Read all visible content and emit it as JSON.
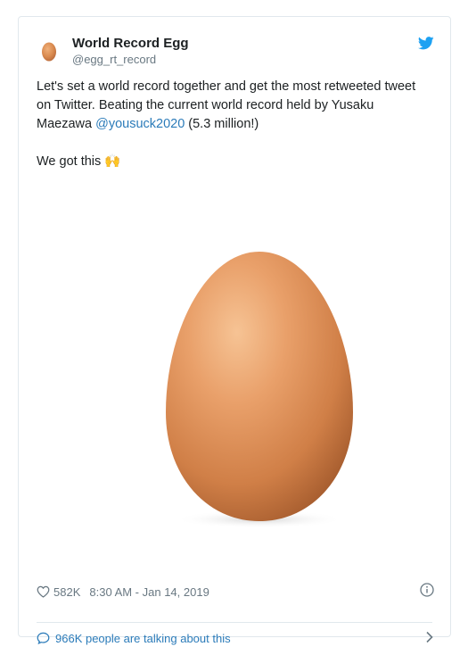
{
  "tweet": {
    "author_name": "World Record Egg",
    "author_handle": "@egg_rt_record",
    "text_line1": "Let's set a world record together and get the most retweeted tweet",
    "text_line2": "on Twitter. Beating the current world record held by Yusaku",
    "text_line3_prefix": "Maezawa ",
    "mention": "@yousuck2020",
    "text_line3_suffix": " (5.3 million!)",
    "text_line4": "We got this ",
    "emoji": "🙌"
  },
  "meta": {
    "likes": "582K",
    "timestamp": "8:30 AM - Jan 14, 2019"
  },
  "footer": {
    "talking": "966K people are talking about this"
  },
  "colors": {
    "accent": "#2b7bb9",
    "twitter_blue": "#1da1f2",
    "muted": "#697882",
    "border": "#e1e8ed"
  },
  "icons": [
    "egg-avatar",
    "twitter-bird-icon",
    "heart-icon",
    "info-icon",
    "speech-bubble-icon",
    "chevron-right-icon"
  ]
}
